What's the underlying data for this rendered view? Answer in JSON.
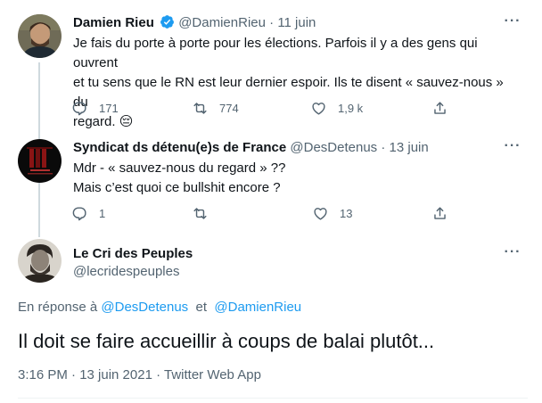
{
  "tweet1": {
    "name": "Damien Rieu",
    "handle": "@DamienRieu",
    "dot": "·",
    "date": "11 juin",
    "text_line1": "Je fais du porte à porte pour les élections. Parfois il y a des gens qui ouvrent",
    "text_line2": "et tu sens que le RN est leur dernier espoir. Ils te disent « sauvez-nous » du",
    "text_line3": "regard.",
    "emoji": "😔",
    "replies": "171",
    "retweets": "774",
    "likes": "1,9 k"
  },
  "tweet2": {
    "name": "Syndicat ds détenu(e)s de France",
    "handle": "@DesDetenus",
    "dot": "·",
    "date": "13 juin",
    "text_line1": "Mdr - « sauvez-nous du regard » ??",
    "text_line2": "Mais c’est quoi ce bullshit encore ?",
    "replies": "1",
    "retweets": "",
    "likes": "13"
  },
  "tweet3": {
    "name": "Le Cri des Peuples",
    "handle": "@lecridespeuples",
    "reply_prefix": "En réponse à",
    "reply_user1": "@DesDetenus",
    "reply_and": "et",
    "reply_user2": "@DamienRieu",
    "text": "Il doit se faire accueillir à coups de balai plutôt...",
    "timestamp": "3:16 PM · 13 juin 2021 · Twitter Web App"
  },
  "colors": {
    "text": "#0f1419",
    "secondary": "#536471",
    "link": "#1d9bf0",
    "thread_line": "#cfd9de"
  }
}
